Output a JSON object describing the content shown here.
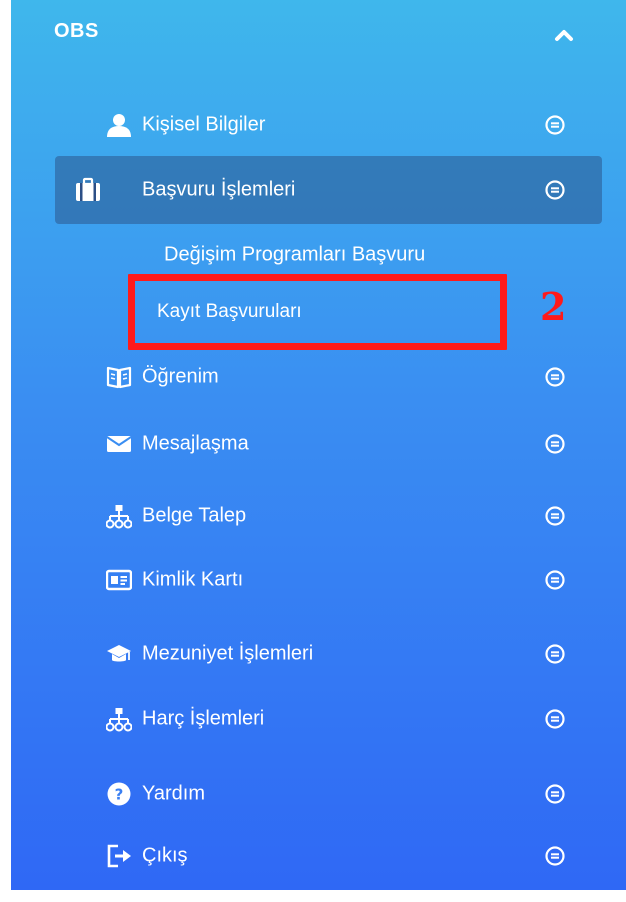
{
  "header": {
    "title": "OBS",
    "toggle_icon": "chevron-up-icon"
  },
  "menu": {
    "items": [
      {
        "label": "Kişisel Bilgiler",
        "icon": "user-icon"
      },
      {
        "label": "Başvuru İşlemleri",
        "icon": "briefcase-icon"
      },
      {
        "label": "Öğrenim",
        "icon": "book-icon"
      },
      {
        "label": "Mesajlaşma",
        "icon": "envelope-icon"
      },
      {
        "label": "Belge Talep",
        "icon": "sitemap-icon"
      },
      {
        "label": "Kimlik Kartı",
        "icon": "id-card-icon"
      },
      {
        "label": "Mezuniyet İşlemleri",
        "icon": "graduation-cap-icon"
      },
      {
        "label": "Harç İşlemleri",
        "icon": "sitemap-icon"
      },
      {
        "label": "Yardım",
        "icon": "question-circle-icon"
      },
      {
        "label": "Çıkış",
        "icon": "sign-out-icon"
      }
    ],
    "submenu": [
      {
        "label": "Değişim Programları Başvuru"
      },
      {
        "label": "Kayıt Başvuruları"
      }
    ]
  },
  "annotation": {
    "number": "2",
    "color": "#ff1a1a"
  },
  "colors": {
    "gradient_top": "#3fb7ec",
    "gradient_bottom": "#2f68f5",
    "active_bg": "#2c4f86",
    "text": "#ffffff"
  }
}
